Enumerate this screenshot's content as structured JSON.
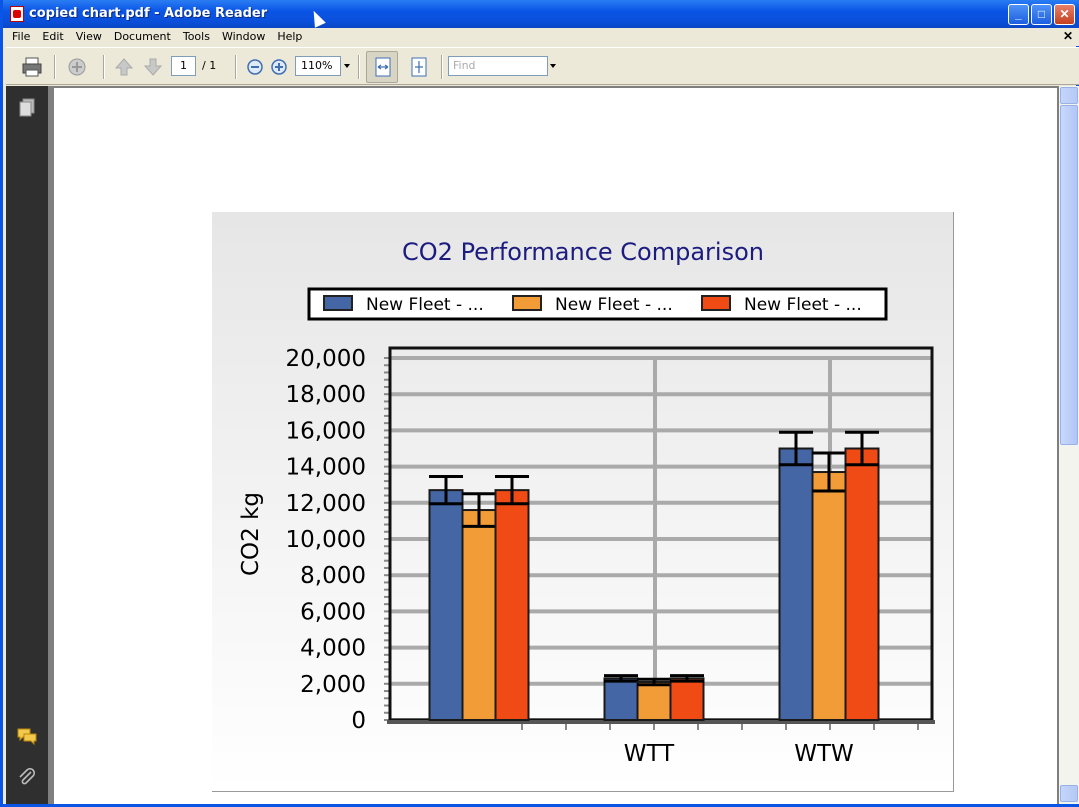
{
  "window": {
    "title": "copied chart.pdf - Adobe Reader",
    "buttons": {
      "minimize": "_",
      "maximize": "□",
      "close": "✕"
    }
  },
  "menubar": {
    "items": [
      "File",
      "Edit",
      "View",
      "Document",
      "Tools",
      "Window",
      "Help"
    ],
    "close": "✕"
  },
  "toolbar": {
    "page_current": "1",
    "page_total": "/ 1",
    "zoom": "110%",
    "find_placeholder": "Find"
  },
  "icons": {
    "print": "print-icon",
    "collaborate": "collaborate-icon",
    "prev_page": "arrow-up-icon",
    "next_page": "arrow-down-icon",
    "zoom_out": "zoom-out-icon",
    "zoom_in": "zoom-in-icon",
    "fit_width": "fit-width-icon",
    "fit_page": "fit-page-icon",
    "pages_panel": "pages-icon",
    "comments_panel": "comments-icon",
    "attachments_panel": "paperclip-icon"
  },
  "colors": {
    "series1": "#4466a4",
    "series2": "#f29c38",
    "series3": "#f04b15",
    "title": "#1c1c80",
    "grid": "#aaaaaa"
  },
  "chart_data": {
    "type": "bar",
    "title": "CO2 Performance Comparison",
    "ylabel": "CO2 kg",
    "xlabel": "",
    "categories": [
      "",
      "WTT",
      "WTW"
    ],
    "ylim": [
      0,
      20000
    ],
    "yticks": [
      "20,000",
      "18,000",
      "16,000",
      "14,000",
      "12,000",
      "10,000",
      "8,000",
      "6,000",
      "4,000",
      "2,000",
      "0"
    ],
    "legend_position": "top",
    "grid": true,
    "series": [
      {
        "name": "New Fleet - ...",
        "values": [
          12700,
          2300,
          15000
        ],
        "error": [
          750,
          150,
          900
        ]
      },
      {
        "name": "New Fleet - ...",
        "values": [
          11600,
          2100,
          13700
        ],
        "error": [
          900,
          150,
          1050
        ]
      },
      {
        "name": "New Fleet - ...",
        "values": [
          12700,
          2300,
          15000
        ],
        "error": [
          750,
          150,
          900
        ]
      }
    ]
  }
}
